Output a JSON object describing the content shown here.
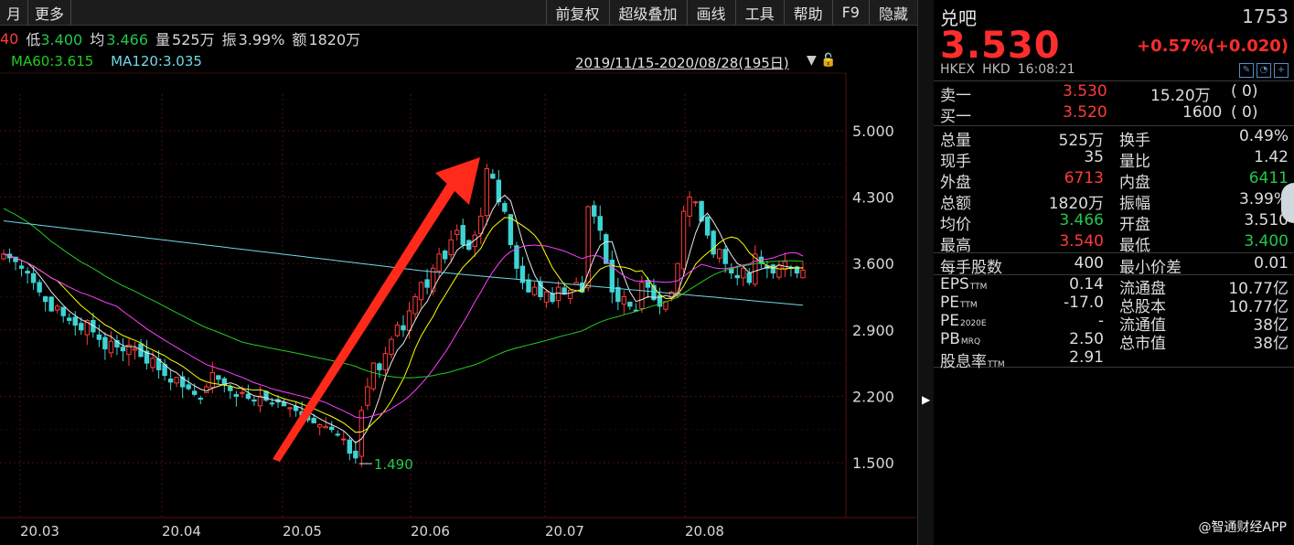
{
  "toolbar": {
    "left": [
      "月",
      "更多"
    ],
    "right": [
      "前复权",
      "超级叠加",
      "画线",
      "工具",
      "帮助",
      "F9",
      "隐藏"
    ]
  },
  "info": {
    "high_partial": "40",
    "low_label": "低",
    "low_value": "3.400",
    "avg_label": "均",
    "avg_value": "3.466",
    "vol_label": "量",
    "vol_value": "525万",
    "amp_label": "振",
    "amp_value": "3.99%",
    "amt_label": "额",
    "amt_value": "1820万"
  },
  "ma": {
    "ma60": "MA60:3.615",
    "ma120": "MA120:3.035"
  },
  "date_range": "2019/11/15-2020/08/28(195日)",
  "colors": {
    "up": "#ff3b3b",
    "down": "#3fd3d3",
    "ma5": "#e8e8e8",
    "ma10": "#ffff00",
    "ma20": "#ff40ff",
    "ma60": "#22cc22",
    "ma120": "#6fd8e8",
    "arrow": "#ff2a1a"
  },
  "chart_data": {
    "type": "candlestick",
    "yticks": [
      "5.000",
      "4.300",
      "3.600",
      "2.900",
      "2.200",
      "1.500"
    ],
    "ylim": [
      1.5,
      5.0
    ],
    "xticks": [
      "20.03",
      "20.04",
      "20.05",
      "20.06",
      "20.07",
      "20.08"
    ],
    "min_annotation": "1.490",
    "min_value": 1.49,
    "closes": [
      3.7,
      3.66,
      3.62,
      3.55,
      3.5,
      3.4,
      3.3,
      3.2,
      3.1,
      3.15,
      3.05,
      3.0,
      2.95,
      2.9,
      3.0,
      2.88,
      2.8,
      2.7,
      2.78,
      2.72,
      2.68,
      2.74,
      2.7,
      2.62,
      2.55,
      2.6,
      2.48,
      2.42,
      2.35,
      2.4,
      2.3,
      2.28,
      2.22,
      2.18,
      2.3,
      2.45,
      2.38,
      2.32,
      2.26,
      2.2,
      2.24,
      2.18,
      2.15,
      2.2,
      2.16,
      2.12,
      2.14,
      2.1,
      2.08,
      2.05,
      2.0,
      1.95,
      1.92,
      1.9,
      1.88,
      1.85,
      1.8,
      1.75,
      1.6,
      1.55,
      2.05,
      2.3,
      2.55,
      2.48,
      2.65,
      2.8,
      2.95,
      2.9,
      3.1,
      3.25,
      3.4,
      3.35,
      3.55,
      3.7,
      3.65,
      3.85,
      3.95,
      3.8,
      3.75,
      3.9,
      4.1,
      4.6,
      4.5,
      4.25,
      4.15,
      3.8,
      3.55,
      3.4,
      3.3,
      3.35,
      3.25,
      3.3,
      3.2,
      3.35,
      3.28,
      3.32,
      3.4,
      3.3,
      4.2,
      4.1,
      3.95,
      3.6,
      3.3,
      3.2,
      3.25,
      3.15,
      3.1,
      3.4,
      3.35,
      3.22,
      3.15,
      3.2,
      3.3,
      3.6,
      4.15,
      4.3,
      4.25,
      4.05,
      3.9,
      3.7,
      3.75,
      3.6,
      3.5,
      3.45,
      3.55,
      3.4,
      3.7,
      3.6,
      3.55,
      3.5,
      3.58,
      3.62,
      3.55,
      3.5,
      3.53
    ]
  },
  "panel": {
    "name": "兑吧",
    "code": "1753",
    "price": "3.530",
    "change": "+0.57%(+0.020)",
    "exchange": "HKEX",
    "currency": "HKD",
    "time": "16:08:21",
    "sell1_label": "卖一",
    "sell1_price": "3.530",
    "sell1_vol": "15.20万",
    "sell1_cnt": "(    0)",
    "buy1_label": "买一",
    "buy1_price": "3.520",
    "buy1_vol": "1600",
    "buy1_cnt": "(    0)",
    "stats": [
      [
        "总量",
        "525万",
        "换手",
        "0.49%"
      ],
      [
        "现手",
        "35",
        "量比",
        "1.42"
      ],
      [
        "外盘",
        "6713",
        "内盘",
        "6411"
      ],
      [
        "总额",
        "1820万",
        "振幅",
        "3.99%"
      ],
      [
        "均价",
        "3.466",
        "开盘",
        "3.510"
      ],
      [
        "最高",
        "3.540",
        "最低",
        "3.400"
      ]
    ],
    "lot_label": "每手股数",
    "lot_value": "400",
    "tick_label": "最小价差",
    "tick_value": "0.01",
    "fin": [
      [
        "EPS",
        "TTM",
        "0.14",
        "流通盘",
        "10.77亿"
      ],
      [
        "PE",
        "TTM",
        "-17.0",
        "总股本",
        "10.77亿"
      ],
      [
        "PE",
        "2020E",
        "-",
        "流通值",
        "38亿"
      ],
      [
        "PB",
        "MRQ",
        "2.50",
        "总市值",
        "38亿"
      ],
      [
        "股息率",
        "TTM",
        "2.91",
        "",
        ""
      ]
    ],
    "watermark": "@智通财经APP"
  }
}
